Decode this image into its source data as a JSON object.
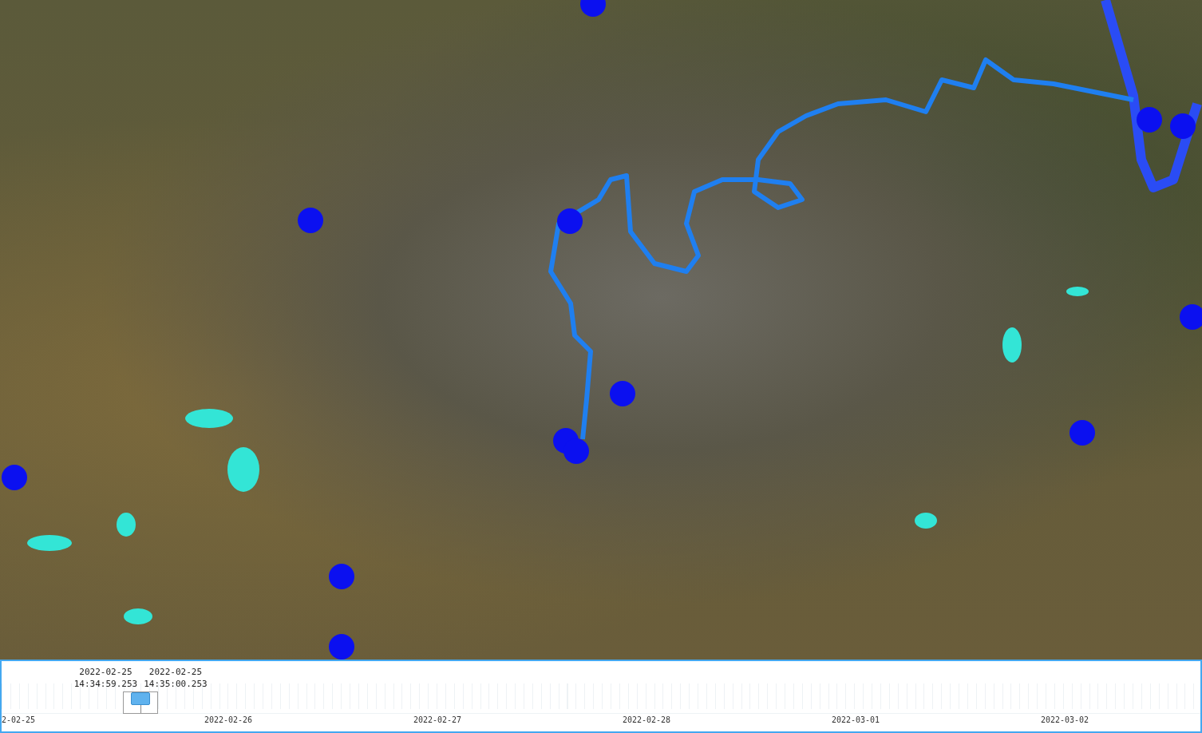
{
  "map": {
    "kind": "satellite"
  },
  "timeline": {
    "level": 0.116,
    "range_start": {
      "date": "2022-02-25",
      "time": "14:34:59.253"
    },
    "range_end": {
      "date": "2022-02-25",
      "time": "14:35:00.253"
    },
    "axis_labels": [
      "2-02-25",
      "2022-02-26",
      "2022-02-27",
      "2022-02-28",
      "2022-03-01",
      "2022-03-02"
    ]
  }
}
